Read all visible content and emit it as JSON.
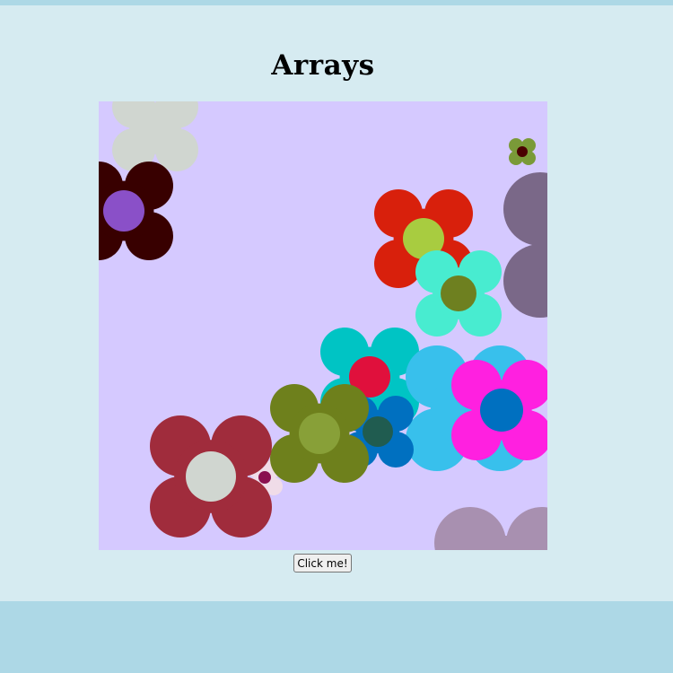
{
  "page": {
    "title": "Arrays"
  },
  "canvas": {
    "background": "#d5c9ff",
    "flowers": [
      {
        "petal": "#d0d6d0",
        "center": "#d0d6d0"
      },
      {
        "petal": "#380000",
        "center": "#8a50c8"
      },
      {
        "petal": "#7a6888",
        "center": "#7a6888"
      },
      {
        "petal": "#7a9a38",
        "center": "#4a0000"
      },
      {
        "petal": "#d8200c",
        "center": "#a8cc40"
      },
      {
        "petal": "#48ecd0",
        "center": "#6e8020"
      },
      {
        "petal": "#00c4c4",
        "center": "#e0103c"
      },
      {
        "petal": "#38c0ec",
        "center": "#38c0ec"
      },
      {
        "petal": "#ff20e0",
        "center": "#0070c0"
      },
      {
        "petal": "#0070c0",
        "center": "#205c50"
      },
      {
        "petal": "#f0dce8",
        "center": "#8a1050"
      },
      {
        "petal": "#6e801c",
        "center": "#88a038"
      },
      {
        "petal": "#a02c3c",
        "center": "#d0d6d0"
      },
      {
        "petal": "#a890b0",
        "center": "#a890b0"
      }
    ]
  },
  "button": {
    "label": "Click me!"
  }
}
